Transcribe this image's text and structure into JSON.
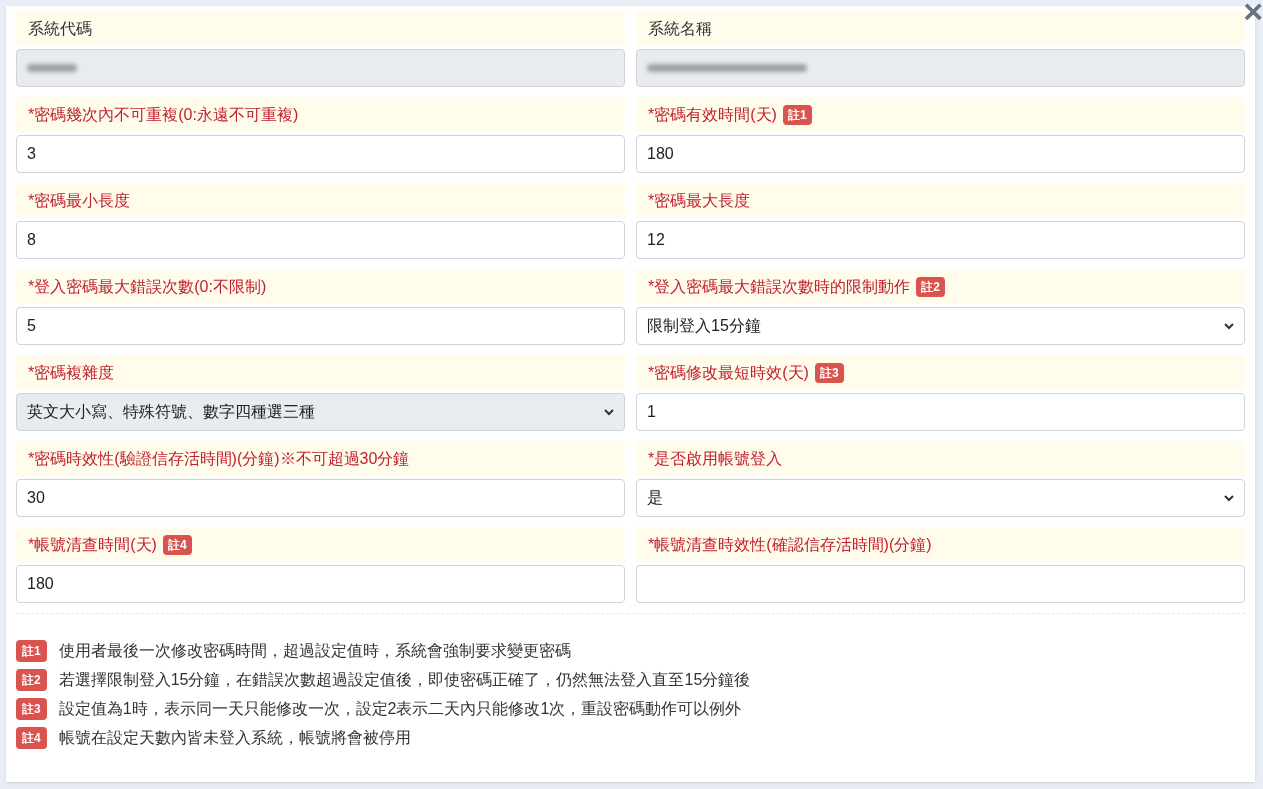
{
  "close_button": "×",
  "fields": [
    {
      "label": "系統代碼",
      "required": false,
      "kind": "input",
      "disabled": true,
      "redacted": true
    },
    {
      "label": "系統名稱",
      "required": false,
      "kind": "input",
      "disabled": true,
      "redacted": true
    },
    {
      "label": "*密碼幾次內不可重複(0:永遠不可重複)",
      "required": true,
      "kind": "input",
      "disabled": false,
      "value": "3"
    },
    {
      "label": "*密碼有效時間(天)",
      "required": true,
      "note": "註1",
      "kind": "input",
      "disabled": false,
      "value": "180"
    },
    {
      "label": "*密碼最小長度",
      "required": true,
      "kind": "input",
      "disabled": false,
      "value": "8"
    },
    {
      "label": "*密碼最大長度",
      "required": true,
      "kind": "input",
      "disabled": false,
      "value": "12"
    },
    {
      "label": "*登入密碼最大錯誤次數(0:不限制)",
      "required": true,
      "kind": "input",
      "disabled": false,
      "value": "5"
    },
    {
      "label": "*登入密碼最大錯誤次數時的限制動作",
      "required": true,
      "note": "註2",
      "kind": "select",
      "disabled": false,
      "value": "限制登入15分鐘"
    },
    {
      "label": "*密碼複雜度",
      "required": true,
      "kind": "select",
      "disabled": true,
      "value": "英文大小寫、特殊符號、數字四種選三種"
    },
    {
      "label": "*密碼修改最短時效(天)",
      "required": true,
      "note": "註3",
      "kind": "input",
      "disabled": false,
      "value": "1"
    },
    {
      "label": "*密碼時效性(驗證信存活時間)(分鐘)※不可超過30分鐘",
      "required": true,
      "kind": "input",
      "disabled": false,
      "value": "30"
    },
    {
      "label": "*是否啟用帳號登入",
      "required": true,
      "kind": "select",
      "disabled": false,
      "value": "是"
    },
    {
      "label": "*帳號清查時間(天)",
      "required": true,
      "note": "註4",
      "kind": "input",
      "disabled": false,
      "value": "180"
    },
    {
      "label": "*帳號清查時效性(確認信存活時間)(分鐘)",
      "required": true,
      "kind": "input",
      "disabled": false
    }
  ],
  "notes": [
    {
      "badge": "註1",
      "text": "使用者最後一次修改密碼時間，超過設定值時，系統會強制要求變更密碼"
    },
    {
      "badge": "註2",
      "text": "若選擇限制登入15分鐘，在錯誤次數超過設定值後，即使密碼正確了，仍然無法登入直至15分鐘後"
    },
    {
      "badge": "註3",
      "text": "設定值為1時，表示同一天只能修改一次，設定2表示二天內只能修改1次，重設密碼動作可以例外"
    },
    {
      "badge": "註4",
      "text": "帳號在設定天數內皆未登入系統，帳號將會被停用"
    }
  ]
}
